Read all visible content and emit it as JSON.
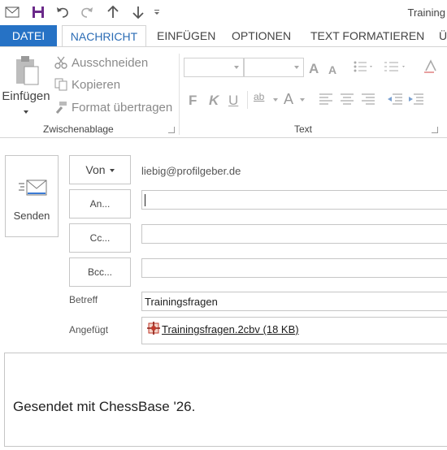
{
  "window": {
    "title": "Training"
  },
  "qat": {
    "icons": [
      "mail-icon",
      "save-icon",
      "undo-icon",
      "redo-icon",
      "up-arrow-icon",
      "down-arrow-icon",
      "customize-icon"
    ]
  },
  "ribbon": {
    "tabs": [
      {
        "label": "DATEI"
      },
      {
        "label": "NACHRICHT"
      },
      {
        "label": "EINFÜGEN"
      },
      {
        "label": "OPTIONEN"
      },
      {
        "label": "TEXT FORMATIEREN"
      },
      {
        "label": "Ü"
      }
    ],
    "clipboard": {
      "paste_label": "Einfügen",
      "cut_label": "Ausschneiden",
      "copy_label": "Kopieren",
      "format_painter_label": "Format übertragen",
      "group_label": "Zwischenablage"
    },
    "text": {
      "group_label": "Text",
      "grow_font": "A",
      "shrink_font": "A",
      "bold": "F",
      "italic": "K",
      "underline": "U",
      "highlight": "ab",
      "font_color": "A"
    }
  },
  "compose": {
    "send_label": "Senden",
    "from_button": "Von",
    "from_address": "liebig@profilgeber.de",
    "to_button": "An...",
    "cc_button": "Cc...",
    "bcc_button": "Bcc...",
    "to_value": "",
    "cc_value": "",
    "bcc_value": "",
    "subject_label": "Betreff",
    "subject_value": "Trainingsfragen",
    "attached_label": "Angefügt",
    "attachment": "Trainingsfragen.2cbv (18 KB)",
    "body_text": "Gesendet mit ChessBase '26."
  },
  "colors": {
    "accent": "#2672c5",
    "active_tab_text": "#2b6cb5",
    "border": "#c6c6c6"
  }
}
